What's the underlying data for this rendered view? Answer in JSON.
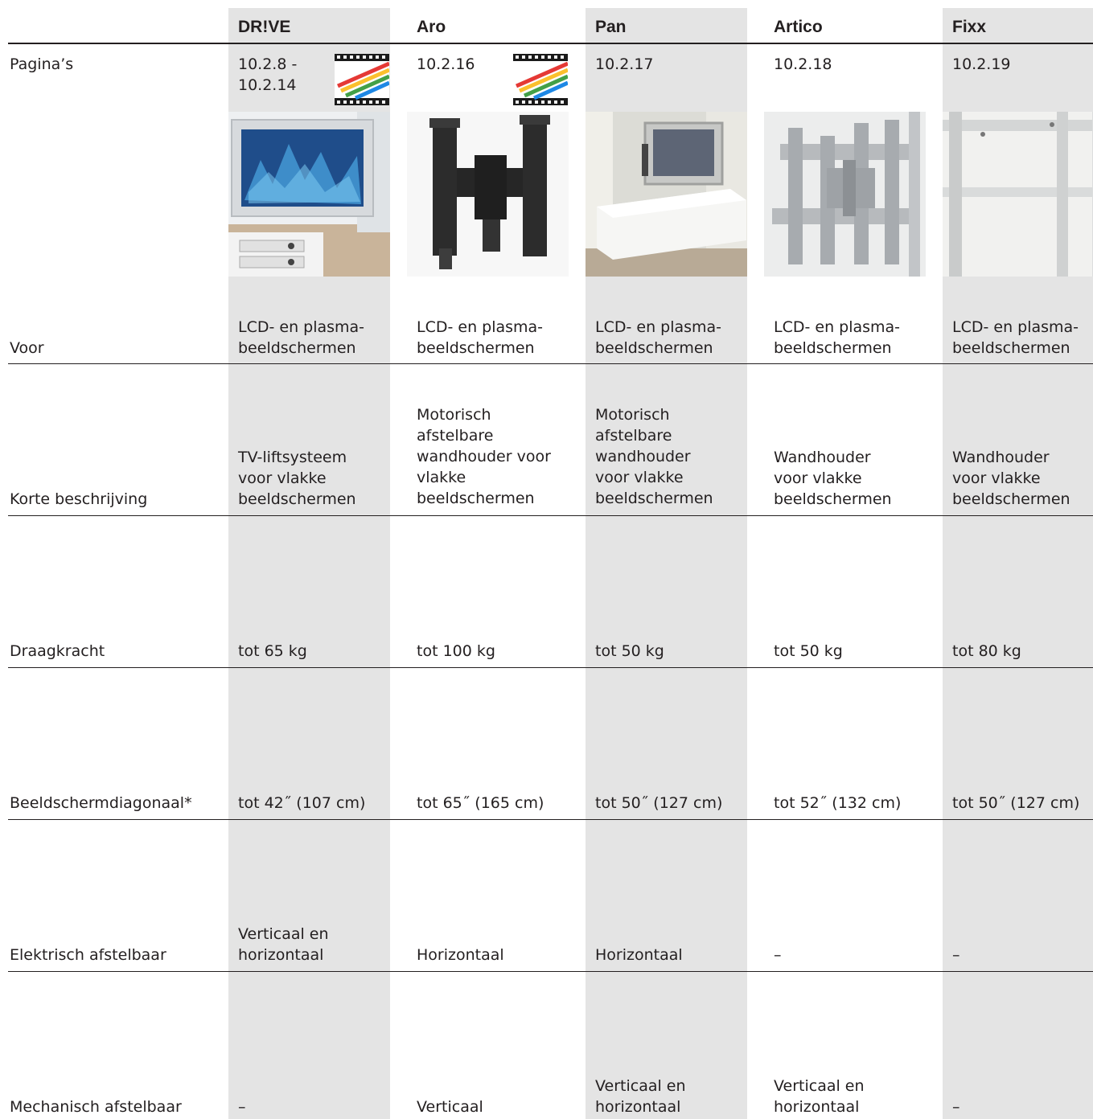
{
  "columns": [
    {
      "name": "DR!VE",
      "pages": "10.2.8 -\n10.2.14",
      "has_video_icon": true,
      "image": "drive-tv-lift-photo",
      "voor": "LCD- en plasma-\nbeeldschermen",
      "beschrijving": "TV-liftsysteem\nvoor vlakke\nbeeldschermen",
      "draagkracht": "tot 65 kg",
      "diagonaal": "tot 42˝ (107 cm)",
      "elektrisch": "Verticaal en\nhorizontaal",
      "mechanisch": "–"
    },
    {
      "name": "Aro",
      "pages": "10.2.16",
      "has_video_icon": true,
      "image": "aro-wall-mount-photo",
      "voor": "LCD- en plasma-\nbeeldschermen",
      "beschrijving": "Motorisch\nafstelbare\nwandhouder voor\nvlakke\nbeeldschermen",
      "draagkracht": "tot 100 kg",
      "diagonaal": "tot 65˝ (165 cm)",
      "elektrisch": "Horizontaal",
      "mechanisch": "Verticaal"
    },
    {
      "name": "Pan",
      "pages": "10.2.17",
      "has_video_icon": false,
      "image": "pan-tv-cabinet-photo",
      "voor": "LCD- en plasma-\nbeeldschermen",
      "beschrijving": "Motorisch\nafstelbare\nwandhouder\nvoor vlakke\nbeeldschermen",
      "draagkracht": "tot 50 kg",
      "diagonaal": "tot 50˝ (127 cm)",
      "elektrisch": "Horizontaal",
      "mechanisch": "Verticaal en\nhorizontaal"
    },
    {
      "name": "Artico",
      "pages": "10.2.18",
      "has_video_icon": false,
      "image": "artico-bracket-photo",
      "voor": "LCD- en plasma-\nbeeldschermen",
      "beschrijving": "Wandhouder\nvoor vlakke\nbeeldschermen",
      "draagkracht": "tot 50 kg",
      "diagonaal": "tot 52˝ (132 cm)",
      "elektrisch": "–",
      "mechanisch": "Verticaal en\nhorizontaal"
    },
    {
      "name": "Fixx",
      "pages": "10.2.19",
      "has_video_icon": false,
      "image": "fixx-wall-rail-photo",
      "voor": "LCD- en plasma-\nbeeldschermen",
      "beschrijving": "Wandhouder\nvoor vlakke\nbeeldschermen",
      "draagkracht": "tot 80 kg",
      "diagonaal": "tot 50˝ (127 cm)",
      "elektrisch": "–",
      "mechanisch": "–"
    }
  ],
  "rows": {
    "paginas": "Pagina’s",
    "voor": "Voor",
    "beschrijving": "Korte beschrijving",
    "draagkracht": "Draagkracht",
    "diagonaal": "Beeldschermdiagonaal*",
    "elektrisch": "Elektrisch afstelbaar",
    "mechanisch": "Mechanisch afstelbaar"
  },
  "colors": {
    "shade": "#e4e4e4",
    "text": "#231f20",
    "rule": "#231f20"
  },
  "icons": {
    "video": "film-strip-icon"
  }
}
